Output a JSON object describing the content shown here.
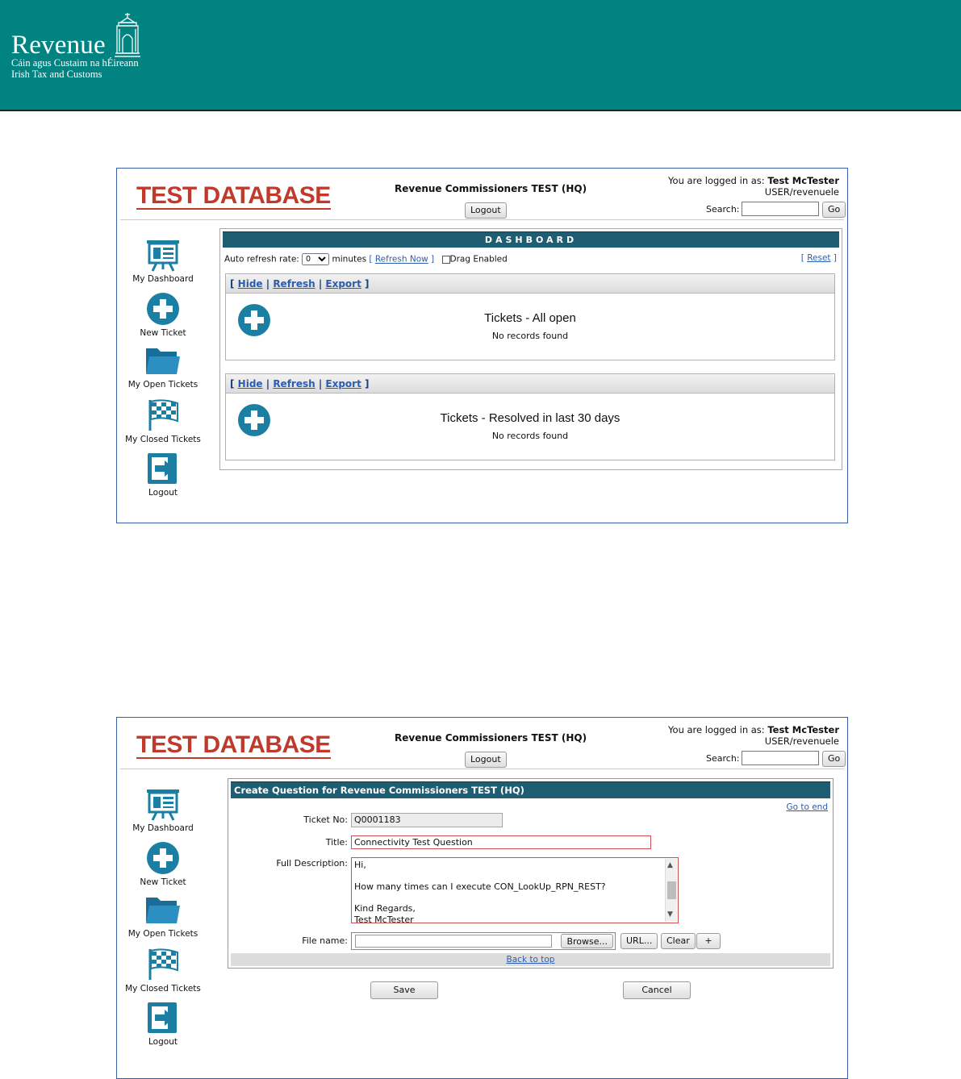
{
  "banner": {
    "logo_word": "Revenue",
    "logo_line1": "Cáin agus Custaim na hÉireann",
    "logo_line2": "Irish Tax and Customs",
    "color": "#018382"
  },
  "app": {
    "brand": "TEST DATABASE",
    "org": "Revenue Commissioners TEST (HQ)",
    "logout_button": "Logout",
    "logged_in_prefix": "You are logged in as:",
    "user_name": "Test McTester",
    "user_login": "USER/revenuele",
    "search_label": "Search:",
    "search_value": "",
    "go_button": "Go",
    "accent": "#1f5d73",
    "brand_color": "#c0392b"
  },
  "nav": [
    {
      "label": "My Dashboard",
      "icon": "dashboard-board-icon"
    },
    {
      "label": "New Ticket",
      "icon": "plus-circle-icon"
    },
    {
      "label": "My Open Tickets",
      "icon": "folder-icon"
    },
    {
      "label": "My Closed Tickets",
      "icon": "checkered-flag-icon"
    },
    {
      "label": "Logout",
      "icon": "exit-arrow-icon"
    }
  ],
  "dashboard": {
    "title": "DASHBOARD",
    "auto_refresh_label": "Auto refresh rate:",
    "auto_refresh_value": "0",
    "minutes_label": "minutes",
    "refresh_now": "Refresh Now",
    "drag_enabled": "Drag Enabled",
    "reset": "Reset",
    "widgets": [
      {
        "hide": "Hide",
        "refresh": "Refresh",
        "export": "Export",
        "title": "Tickets - All open",
        "message": "No records found"
      },
      {
        "hide": "Hide",
        "refresh": "Refresh",
        "export": "Export",
        "title": "Tickets - Resolved in last 30 days",
        "message": "No records found"
      }
    ]
  },
  "create_form": {
    "title": "Create Question for Revenue Commissioners TEST (HQ)",
    "go_to_end": "Go to end",
    "ticket_no_label": "Ticket No:",
    "ticket_no_value": "Q0001183",
    "title_label": "Title:",
    "title_value": "Connectivity Test Question",
    "description_label": "Full Description:",
    "description_lines": [
      "Hi,",
      "",
      "How many times can I execute CON_LookUp_RPN_REST?",
      "",
      "Kind Regards,",
      "Test McTester"
    ],
    "file_label": "File name:",
    "browse_button": "Browse...",
    "url_button": "URL...",
    "clear_button": "Clear",
    "add_button": "+",
    "back_to_top": "Back to top",
    "save_button": "Save",
    "cancel_button": "Cancel"
  }
}
